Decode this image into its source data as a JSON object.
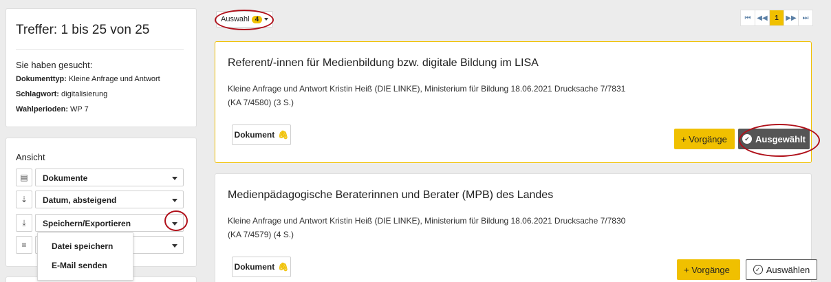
{
  "results": {
    "count_text": "Treffer: 1 bis 25 von 25",
    "searched_heading": "Sie haben gesucht:",
    "criteria": [
      {
        "label": "Dokumenttyp:",
        "value": "Kleine Anfrage und Antwort"
      },
      {
        "label": "Schlagwort:",
        "value": "digitalisierung"
      },
      {
        "label": "Wahlperioden:",
        "value": "WP 7"
      }
    ]
  },
  "view": {
    "heading": "Ansicht",
    "controls": [
      {
        "icon": "list-icon",
        "label": "Dokumente"
      },
      {
        "icon": "sort-icon",
        "label": "Datum, absteigend"
      },
      {
        "icon": "download-icon",
        "label": "Speichern/Exportieren"
      },
      {
        "icon": "menu-icon",
        "label": ""
      }
    ],
    "export_menu": [
      "Datei speichern",
      "E-Mail senden"
    ]
  },
  "selection": {
    "label": "Auswahl",
    "count": "4"
  },
  "pager": {
    "first": "⏮",
    "prev": "◀◀",
    "current": "1",
    "next": "▶▶",
    "last": "⏭"
  },
  "documents": [
    {
      "title": "Referent/-innen für Medienbildung bzw. digitale Bildung im LISA",
      "subtitle": "Kleine Anfrage und Antwort Kristin Heiß (DIE LINKE), Ministerium für Bildung 18.06.2021 Drucksache 7/7831 (KA 7/4580) (3 S.)",
      "doc_label": "Dokument",
      "vorgaenge_label": "+ Vorgänge",
      "select_label": "Ausgewählt",
      "selected": true
    },
    {
      "title": "Medienpädagogische Beraterinnen und Berater (MPB) des Landes",
      "subtitle": "Kleine Anfrage und Antwort Kristin Heiß (DIE LINKE), Ministerium für Bildung 18.06.2021 Drucksache 7/7830 (KA 7/4579) (4 S.)",
      "doc_label": "Dokument",
      "vorgaenge_label": "+ Vorgänge",
      "select_label": "Auswählen",
      "selected": false
    }
  ],
  "colors": {
    "accent": "#f0c000",
    "highlight_ring": "#b0101a",
    "selected_button": "#555555"
  }
}
